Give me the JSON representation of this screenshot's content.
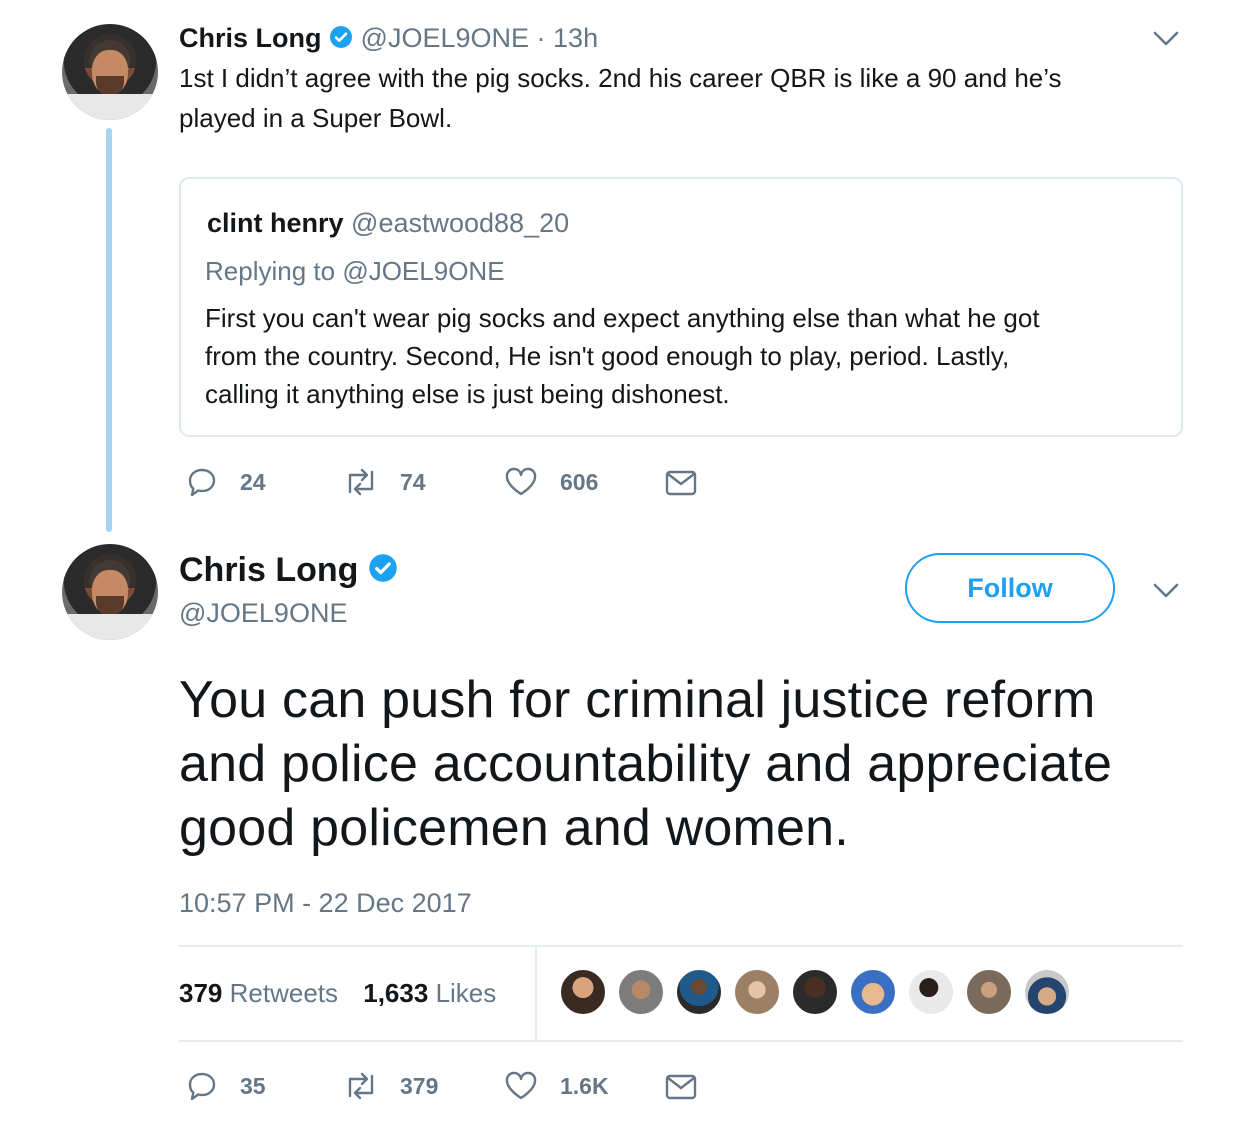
{
  "reply_tweet": {
    "author_name": "Chris Long",
    "author_handle": "@JOEL9ONE",
    "separator": "·",
    "time_ago": "13h",
    "text_line1": "1st I didn’t agree with the pig socks. 2nd his career QBR is like a 90 and he’s",
    "text_line2": "played in a Super Bowl.",
    "quoted": {
      "author_name": "clint henry",
      "author_handle": "@eastwood88_20",
      "replying_prefix": "Replying to ",
      "replying_handle": "@JOEL9ONE",
      "text_line1": "First you can't wear pig socks and expect anything else than what he got",
      "text_line2": "from the country.  Second, He isn't good enough to play, period.  Lastly,",
      "text_line3": "calling it anything else is just being dishonest."
    },
    "actions": {
      "replies": "24",
      "retweets": "74",
      "likes": "606"
    }
  },
  "main_tweet": {
    "author_name": "Chris Long",
    "author_handle": "@JOEL9ONE",
    "follow_label": "Follow",
    "text_line1": "You can push for criminal justice reform",
    "text_line2": "and police accountability and appreciate",
    "text_line3": "good policemen and women.",
    "timestamp": "10:57 PM - 22 Dec 2017",
    "stats": {
      "retweets_count": "379",
      "retweets_label": "Retweets",
      "likes_count": "1,633",
      "likes_label": "Likes"
    },
    "actions": {
      "replies": "35",
      "retweets": "379",
      "likes": "1.6K"
    }
  },
  "colors": {
    "accent": "#1da1f2",
    "muted": "#657786",
    "thread_line": "#a6d3f2",
    "border": "#e1e8ed"
  },
  "icons": [
    "verified-badge-icon",
    "chevron-down-icon",
    "reply-icon",
    "retweet-icon",
    "like-icon",
    "direct-message-icon"
  ]
}
